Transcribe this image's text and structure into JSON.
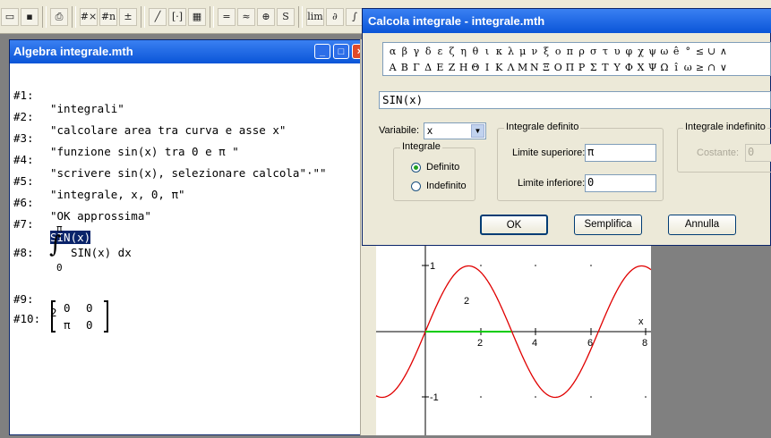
{
  "toolbar": {
    "icons": [
      "open-icon",
      "save-icon",
      "print-icon",
      "matrix-icon",
      "number-icon",
      "approx-icon",
      "line-icon",
      "vector-icon",
      "grid-icon",
      "equals-icon",
      "approx-equals-icon",
      "zoom-icon",
      "substitute-icon",
      "limit-icon",
      "derivative-icon",
      "integral-icon"
    ],
    "labels": {
      "number": "#n",
      "lim": "lim",
      "deriv": "∂",
      "integral": "∫",
      "equals": "=",
      "approx": "≈",
      "sub": "S",
      "matrix": "#×"
    }
  },
  "algebra_window": {
    "title": "Algebra  integrale.mth",
    "expressions": [
      {
        "label": "#1:",
        "text": "\"integrali\""
      },
      {
        "label": "#2:",
        "text": "\"calcolare area tra curva e asse x\""
      },
      {
        "label": "#3:",
        "text": "\"funzione sin(x) tra 0 e π \""
      },
      {
        "label": "#4:",
        "text": "\"scrivere sin(x), selezionare calcola\"·\"\""
      },
      {
        "label": "#5:",
        "text": "\"integrale, x, 0, π\""
      },
      {
        "label": "#6:",
        "text": "\"OK approssima\""
      },
      {
        "label": "#7:",
        "text": "SIN(x)"
      },
      {
        "label": "#8:",
        "upper": "π",
        "integrand": "SIN(x) dx",
        "lower": "0"
      },
      {
        "label": "#9:",
        "text": "2"
      },
      {
        "label": "#10:",
        "matrix": [
          [
            "0",
            "0"
          ],
          [
            "π",
            "0"
          ]
        ]
      }
    ]
  },
  "graph": {
    "y_ticks": [
      "1",
      "-1"
    ],
    "x_ticks": [
      "2",
      "4",
      "6",
      "8"
    ],
    "x_axis_label": "x",
    "area_label": "2",
    "curve_color": "#e00000",
    "segment_color": "#00cc00"
  },
  "dialog": {
    "title": "Calcola integrale - integrale.mth",
    "symbols_row1": [
      "α",
      "β",
      "γ",
      "δ",
      "ε",
      "ζ",
      "η",
      "θ",
      "ι",
      "κ",
      "λ",
      "μ",
      "ν",
      "ξ",
      "ο",
      "π",
      "ρ",
      "σ",
      "τ",
      "υ",
      "φ",
      "χ",
      "ψ",
      "ω",
      "ê",
      "°",
      "≤",
      "∪",
      "∧"
    ],
    "symbols_row2": [
      "Α",
      "Β",
      "Γ",
      "Δ",
      "Ε",
      "Ζ",
      "Η",
      "Θ",
      "Ι",
      "Κ",
      "Λ",
      "Μ",
      "Ν",
      "Ξ",
      "Ο",
      "Π",
      "Ρ",
      "Σ",
      "Τ",
      "Υ",
      "Φ",
      "Χ",
      "Ψ",
      "Ω",
      "î",
      "ω",
      "≥",
      "∩",
      "∨"
    ],
    "expression": "SIN(x)",
    "variable_label": "Variabile:",
    "variable_value": "x",
    "integral_group_label": "Integrale",
    "radio_definite": "Definito",
    "radio_indefinite": "Indefinito",
    "definite_group_label": "Integrale definito",
    "upper_label": "Limite superiore:",
    "upper_value": "π",
    "lower_label": "Limite inferiore:",
    "lower_value": "0",
    "indefinite_group_label": "Integrale indefinito",
    "constant_label": "Costante:",
    "constant_value": "0",
    "ok_label": "OK",
    "simplify_label": "Semplifica",
    "cancel_label": "Annulla"
  }
}
